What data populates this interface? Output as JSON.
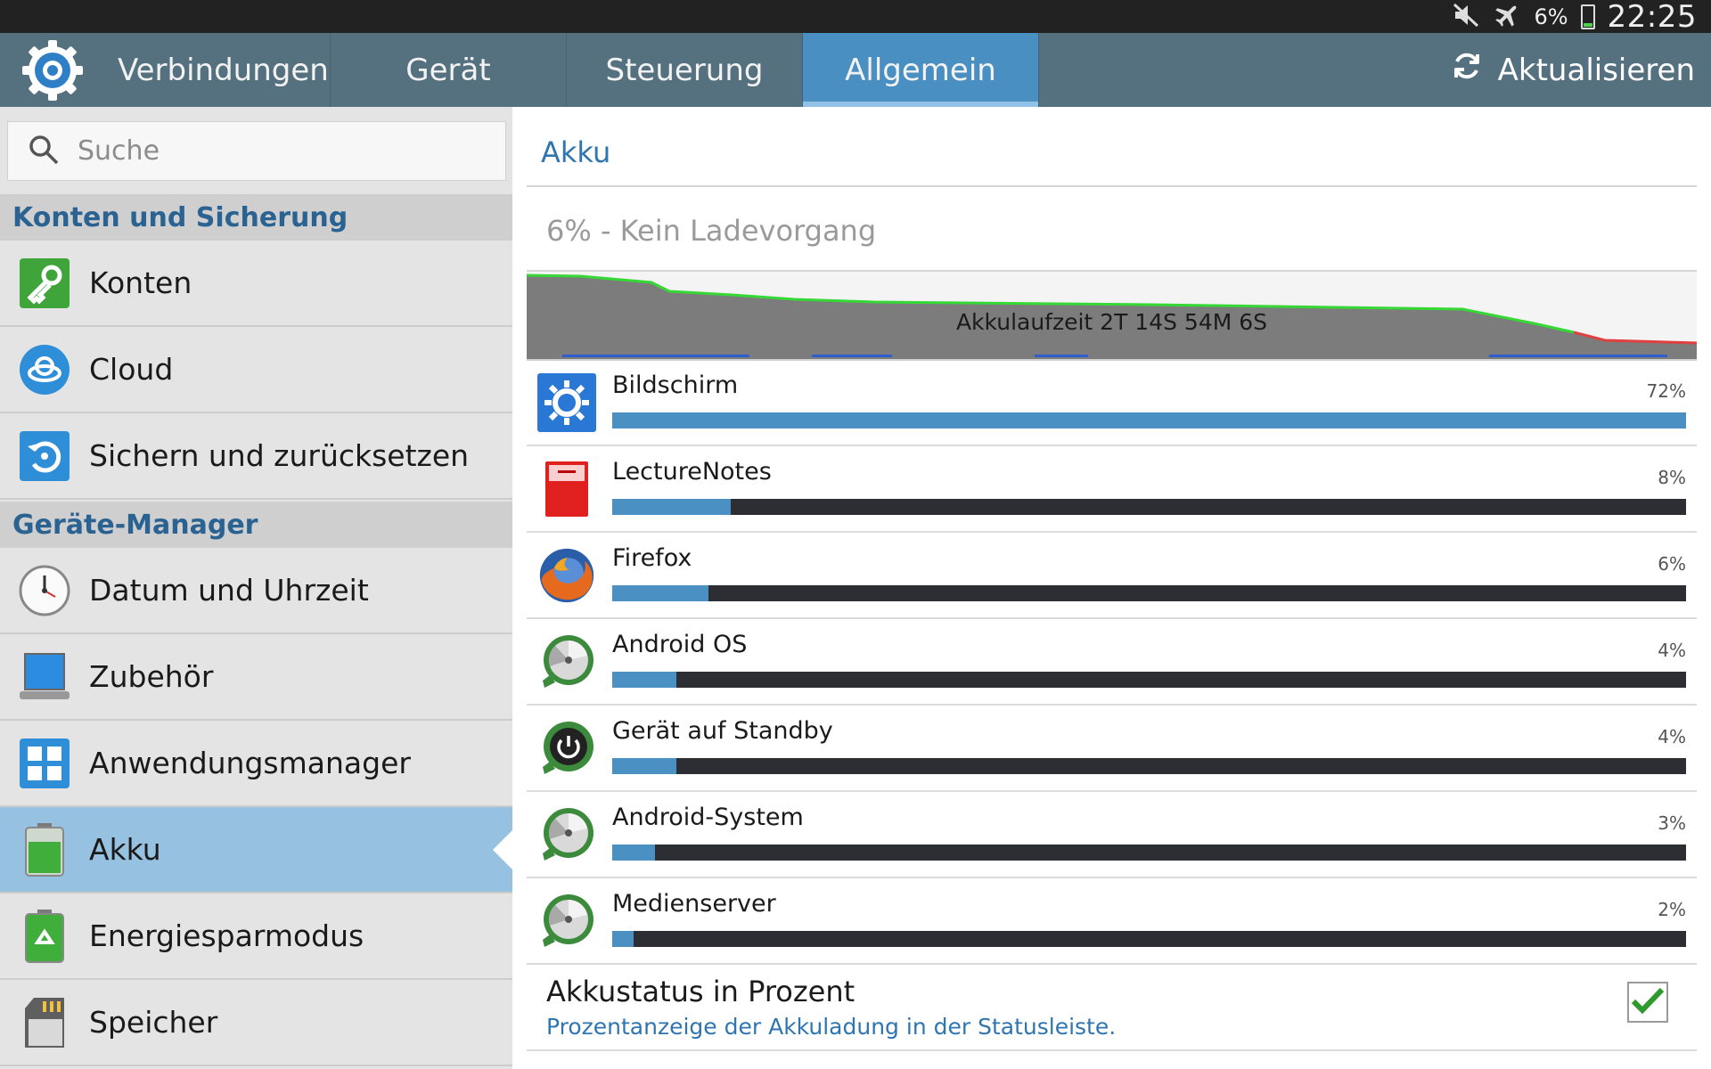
{
  "status_bar": {
    "battery_pct": "6%",
    "time": "22:25",
    "icons": [
      "mute-icon",
      "airplane-mode-icon",
      "battery-icon"
    ]
  },
  "action_bar": {
    "tabs": [
      {
        "label": "Verbindungen"
      },
      {
        "label": "Gerät"
      },
      {
        "label": "Steuerung"
      },
      {
        "label": "Allgemein",
        "active": true
      }
    ],
    "refresh_label": "Aktualisieren"
  },
  "sidebar": {
    "search_placeholder": "Suche",
    "section1": "Konten und Sicherung",
    "section2": "Geräte-Manager",
    "items": [
      {
        "label": "Konten",
        "icon": "key-icon"
      },
      {
        "label": "Cloud",
        "icon": "cloud-icon"
      },
      {
        "label": "Sichern und zurücksetzen",
        "icon": "backup-icon"
      },
      {
        "label": "Datum und Uhrzeit",
        "icon": "clock-icon"
      },
      {
        "label": "Zubehör",
        "icon": "accessory-icon"
      },
      {
        "label": "Anwendungsmanager",
        "icon": "apps-icon"
      },
      {
        "label": "Akku",
        "icon": "battery-icon",
        "active": true
      },
      {
        "label": "Energiesparmodus",
        "icon": "power-saving-icon"
      },
      {
        "label": "Speicher",
        "icon": "storage-icon"
      }
    ]
  },
  "main": {
    "title": "Akku",
    "status": "6% - Kein Ladevorgang",
    "graph_caption": "Akkulaufzeit 2T 14S 54M 6S",
    "usage": [
      {
        "name": "Bildschirm",
        "pct_label": "72%",
        "pct": 100,
        "icon": "display-icon"
      },
      {
        "name": "LectureNotes",
        "pct_label": "8%",
        "pct": 11,
        "icon": "notebook-icon"
      },
      {
        "name": "Firefox",
        "pct_label": "6%",
        "pct": 9,
        "icon": "firefox-icon"
      },
      {
        "name": "Android OS",
        "pct_label": "4%",
        "pct": 6,
        "icon": "android-os-icon"
      },
      {
        "name": "Gerät auf Standby",
        "pct_label": "4%",
        "pct": 6,
        "icon": "standby-icon"
      },
      {
        "name": "Android-System",
        "pct_label": "3%",
        "pct": 4,
        "icon": "android-system-icon"
      },
      {
        "name": "Medienserver",
        "pct_label": "2%",
        "pct": 2,
        "icon": "media-server-icon"
      }
    ],
    "setting": {
      "title": "Akkustatus in Prozent",
      "subtitle": "Prozentanzeige der Akkuladung in der Statusleiste.",
      "checked": true
    }
  },
  "colors": {
    "action_bar": "#55707f",
    "active_tab": "#4a8fc1",
    "active_item": "#97c1e0",
    "usage_fill": "#4a90c2",
    "accent_text": "#2f75b0"
  }
}
